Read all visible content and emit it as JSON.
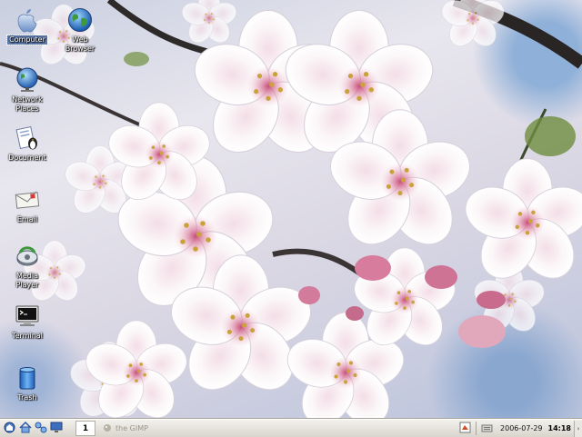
{
  "desktop": {
    "icons": [
      {
        "label": "Computer",
        "icon": "apple-computer-icon"
      },
      {
        "label": "Web\nBrowser",
        "icon": "globe-icon"
      },
      {
        "label": "Network\nPlaces",
        "icon": "network-globe-icon"
      },
      {
        "label": "Document",
        "icon": "document-penguin-icon"
      },
      {
        "label": "Email",
        "icon": "envelope-icon"
      },
      {
        "label": "Media\nPlayer",
        "icon": "media-player-icon"
      },
      {
        "label": "Terminal",
        "icon": "terminal-icon"
      },
      {
        "label": "Trash",
        "icon": "trash-can-icon"
      }
    ],
    "selected_icon": "Computer"
  },
  "taskbar": {
    "launchers": [
      "start-menu-icon",
      "home-icon",
      "network-icon",
      "monitor-icon"
    ],
    "workspace": "1",
    "task": "the GIMP",
    "date": "2006-07-29",
    "time": "14:18",
    "tray_icons": [
      "gimp-tray-icon",
      "keyboard-icon"
    ],
    "panel_arrow": "›"
  },
  "colors": {
    "taskbar_bg": "#e4e1da",
    "selection": "#5f7db0",
    "blossom": "#ffffff",
    "blossom_center": "#e9a0b4"
  }
}
